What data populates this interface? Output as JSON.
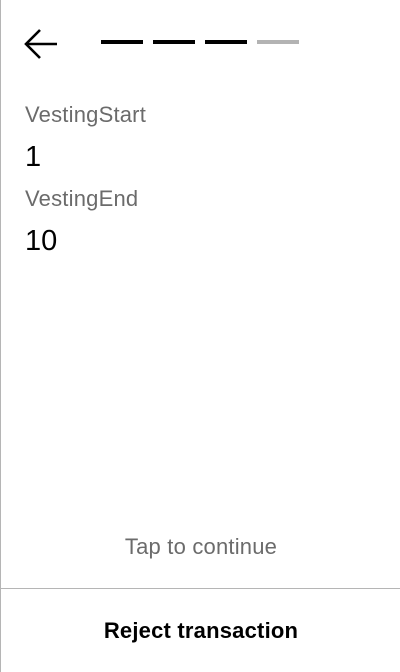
{
  "header": {
    "back_icon": "arrow-left-icon",
    "progress": {
      "total_steps": 4,
      "completed_steps": 3,
      "active_color": "#000000",
      "inactive_color": "#b3b3b3"
    }
  },
  "fields": [
    {
      "label": "VestingStart",
      "value": "1"
    },
    {
      "label": "VestingEnd",
      "value": "10"
    }
  ],
  "footer": {
    "tap_hint": "Tap to continue",
    "reject_label": "Reject transaction"
  }
}
